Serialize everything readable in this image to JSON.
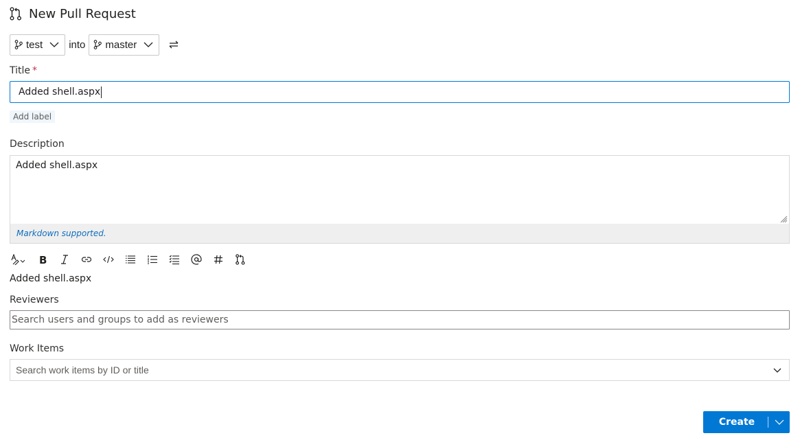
{
  "header": {
    "title": "New Pull Request",
    "icon": "pull-request-icon"
  },
  "branches": {
    "source": "test",
    "into_label": "into",
    "target": "master",
    "swap_icon": "swap-arrows-icon"
  },
  "title_field": {
    "label": "Title",
    "required_marker": "*",
    "value": "Added shell.aspx"
  },
  "add_label": "Add label",
  "description": {
    "label": "Description",
    "value": "Added shell.aspx",
    "footer": "Markdown supported."
  },
  "toolbar": {
    "items": [
      "format-icon",
      "bold-icon",
      "italic-icon",
      "link-icon",
      "code-icon",
      "bulleted-list-icon",
      "numbered-list-icon",
      "task-list-icon",
      "mention-icon",
      "work-item-hash-icon",
      "pull-request-icon"
    ]
  },
  "preview_text": "Added shell.aspx",
  "reviewers": {
    "label": "Reviewers",
    "placeholder": "Search users and groups to add as reviewers"
  },
  "work_items": {
    "label": "Work Items",
    "placeholder": "Search work items by ID or title"
  },
  "create_button": {
    "label": "Create"
  },
  "colors": {
    "accent": "#0078d4",
    "required": "#c4314b",
    "link": "#106ebe"
  }
}
